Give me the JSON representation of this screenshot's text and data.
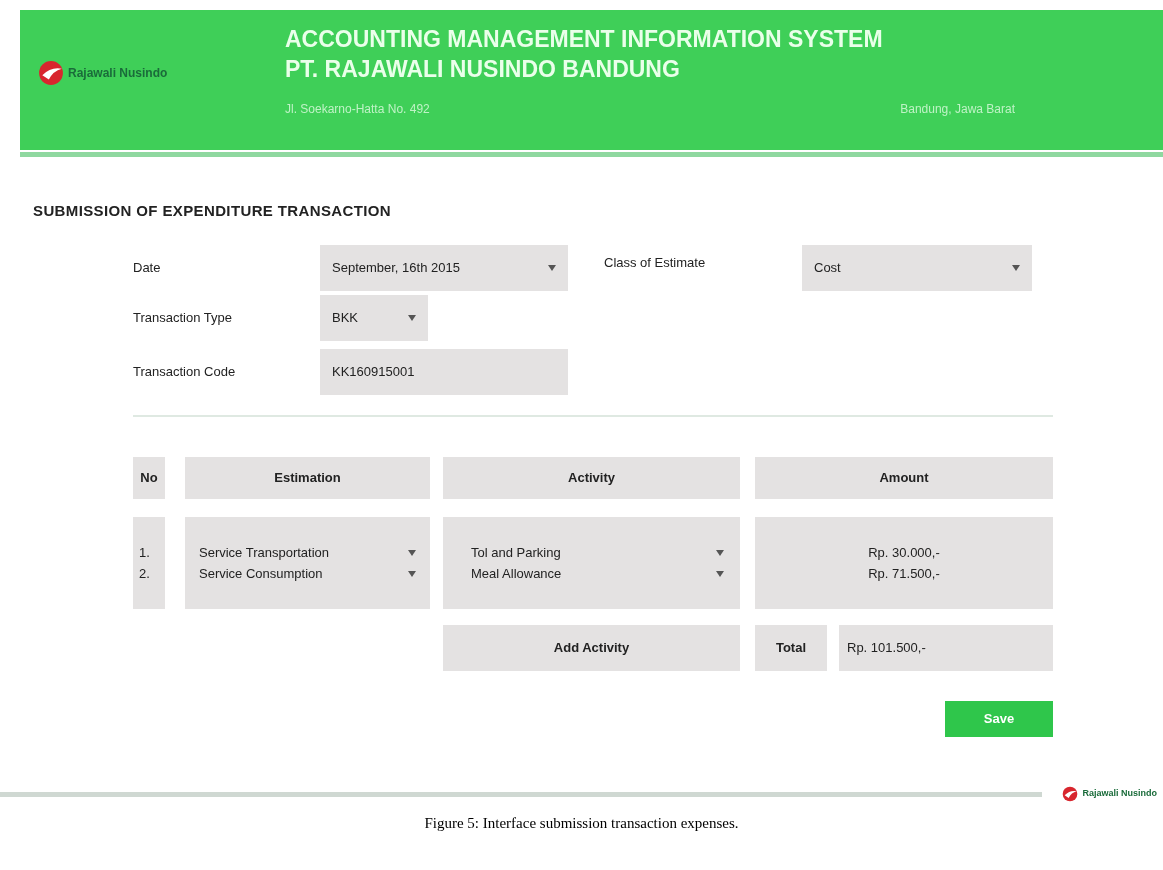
{
  "header": {
    "logo_text": "Rajawali Nusindo",
    "title": "ACCOUNTING MANAGEMENT INFORMATION SYSTEM",
    "subtitle": "PT. RAJAWALI NUSINDO BANDUNG",
    "address": "Jl. Soekarno-Hatta No. 492",
    "city": "Bandung, Jawa Barat"
  },
  "page_title": "SUBMISSION OF EXPENDITURE TRANSACTION",
  "form": {
    "date": {
      "label": "Date",
      "value": "September, 16th 2015"
    },
    "class_of_estimate": {
      "label": "Class of Estimate",
      "value": "Cost"
    },
    "transaction_type": {
      "label": "Transaction Type",
      "value": "BKK"
    },
    "transaction_code": {
      "label": "Transaction Code",
      "value": "KK160915001"
    }
  },
  "table": {
    "columns": [
      "No",
      "Estimation",
      "Activity",
      "Amount"
    ],
    "rows": [
      {
        "no": "1.",
        "estimation": "Service Transportation",
        "activity": "Tol and Parking",
        "amount": "Rp. 30.000,-"
      },
      {
        "no": "2.",
        "estimation": "Service Consumption",
        "activity": "Meal Allowance",
        "amount": "Rp. 71.500,-"
      }
    ],
    "add_button": "Add Activity",
    "total_label": "Total",
    "total_value": "Rp. 101.500,-"
  },
  "save_button": "Save",
  "footer": {
    "logo_text": "Rajawali Nusindo"
  },
  "caption": "Figure 5: Interface submission transaction expenses."
}
